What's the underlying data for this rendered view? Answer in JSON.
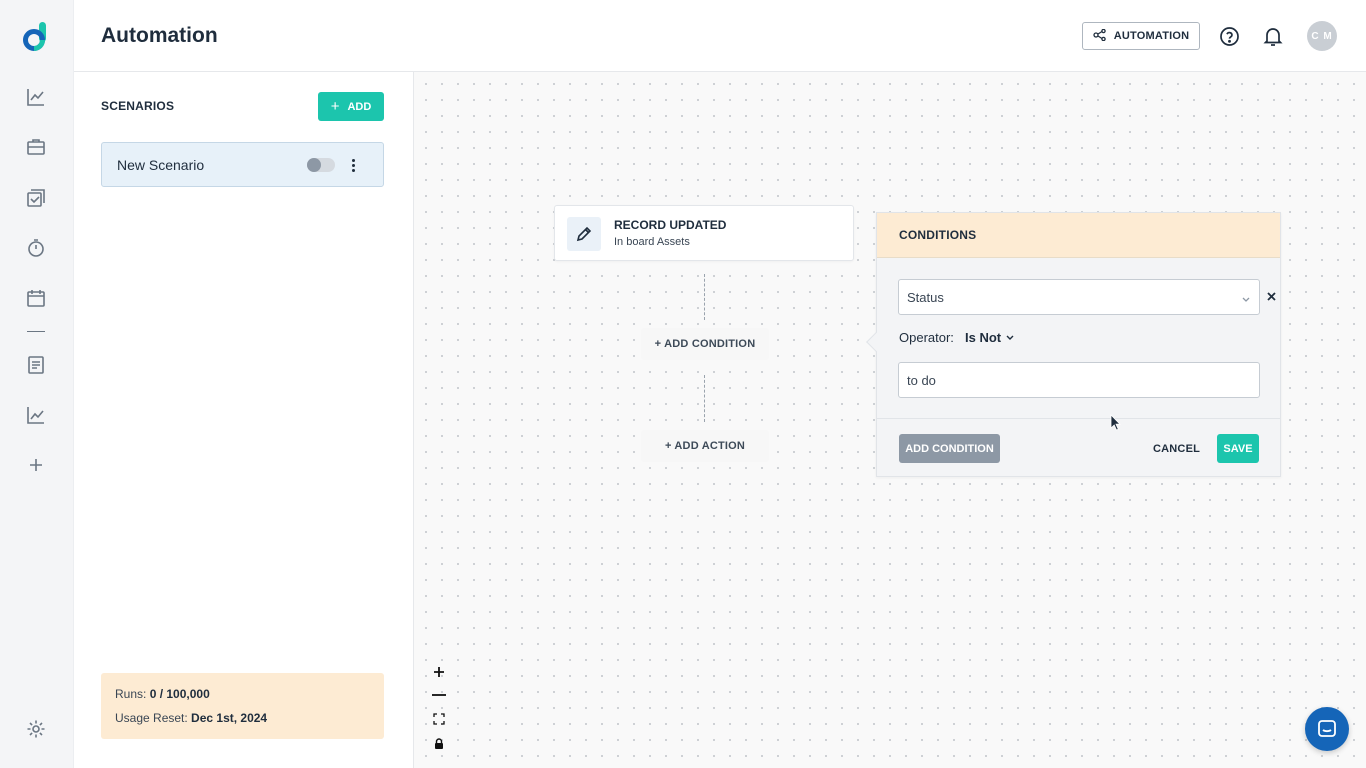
{
  "app": {
    "logo_icon": "d-logo-icon",
    "brand_color": "#1cc5ad",
    "title": "Automation"
  },
  "sidebar": {
    "items": [
      {
        "name": "dashboard",
        "icon": "line-chart-icon"
      },
      {
        "name": "projects",
        "icon": "briefcase-icon"
      },
      {
        "name": "tasks",
        "icon": "checklist-icon"
      },
      {
        "name": "timer",
        "icon": "stopwatch-icon"
      },
      {
        "name": "calendar",
        "icon": "calendar-icon"
      },
      {
        "name": "documents",
        "icon": "document-icon"
      },
      {
        "name": "reports",
        "icon": "chart-icon"
      },
      {
        "name": "add",
        "icon": "plus-icon"
      }
    ],
    "settings_icon": "gear-icon"
  },
  "header": {
    "automation_button_label": "AUTOMATION",
    "help_icon": "help-circle-icon",
    "bell_icon": "bell-icon",
    "avatar_initials": "C M"
  },
  "scenarios": {
    "title": "SCENARIOS",
    "add_label": "ADD",
    "items": [
      {
        "name": "New Scenario",
        "enabled": false
      }
    ]
  },
  "usage": {
    "runs_label": "Runs:",
    "runs_value": "0 / 100,000",
    "reset_label": "Usage Reset:",
    "reset_value": "Dec 1st, 2024"
  },
  "canvas": {
    "trigger": {
      "title": "RECORD UPDATED",
      "subtitle": "In board Assets",
      "icon": "pencil-icon"
    },
    "add_condition_label": "+ ADD CONDITION",
    "add_action_label": "+ ADD ACTION"
  },
  "conditions": {
    "title": "CONDITIONS",
    "field_value": "Status",
    "operator_label": "Operator:",
    "operator_value": "Is Not",
    "value_input": "to do",
    "add_condition_label": "ADD CONDITION",
    "cancel_label": "CANCEL",
    "save_label": "SAVE"
  },
  "zoom_controls": [
    "zoom-in-icon",
    "zoom-out-icon",
    "fit-view-icon",
    "lock-icon"
  ],
  "chat_icon": "chat-icon"
}
